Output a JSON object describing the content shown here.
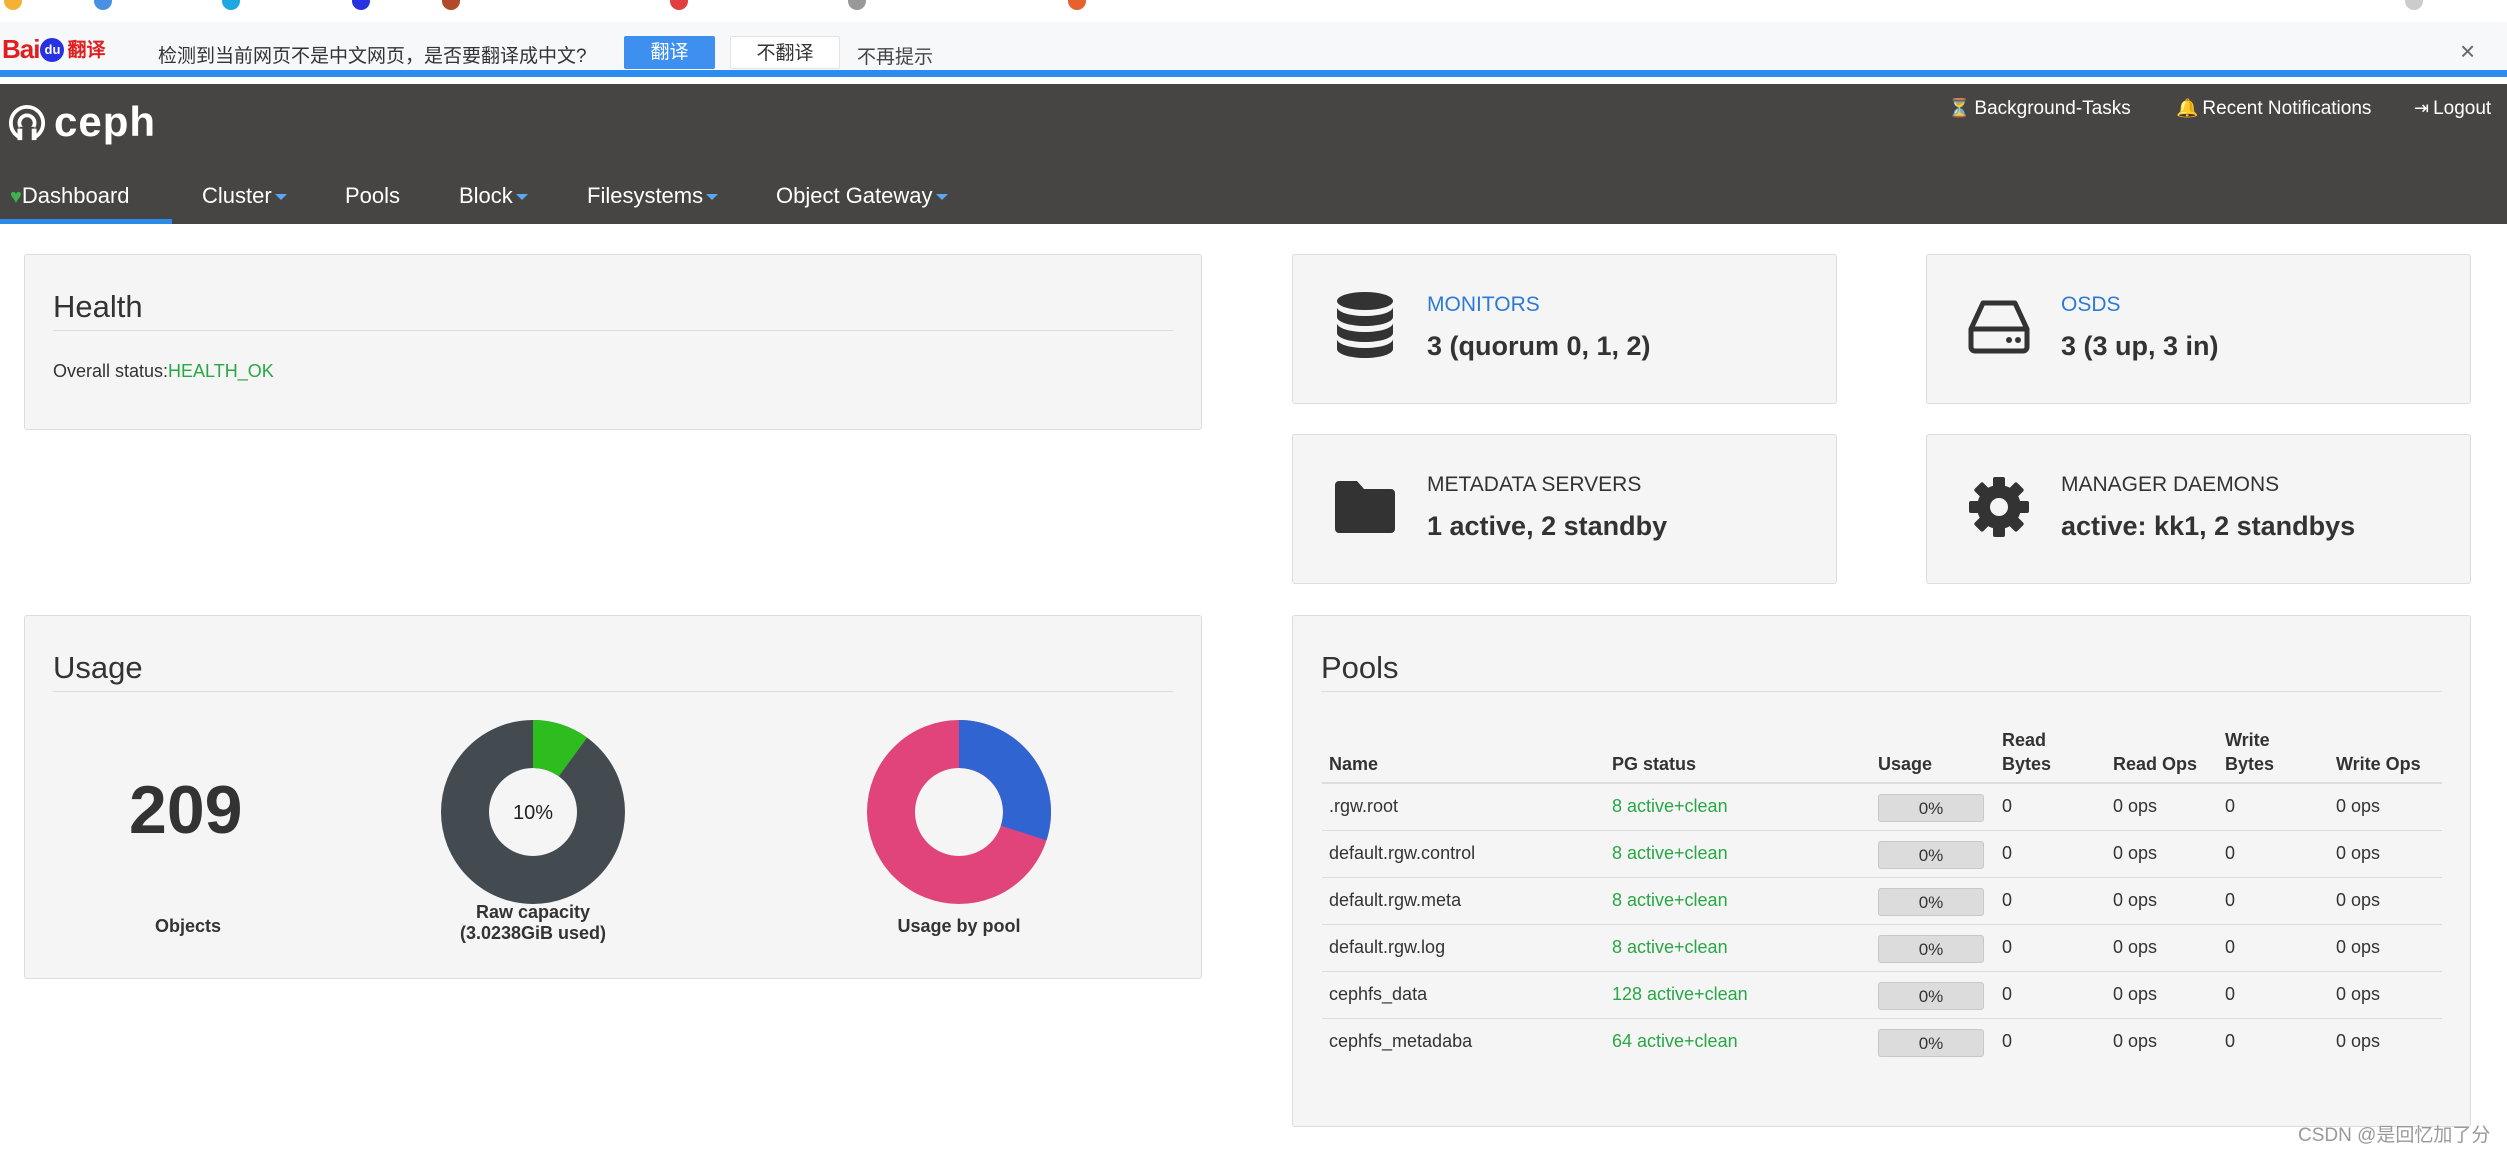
{
  "translate_bar": {
    "logo_bai": "Bai",
    "logo_du": "du",
    "logo_fanyi": "翻译",
    "message": "检测到当前网页不是中文网页，是否要翻译成中文?",
    "translate_button": "翻译",
    "no_translate_button": "不翻译",
    "never_show": "不再提示",
    "close_glyph": "×"
  },
  "header": {
    "brand": "ceph",
    "links": {
      "background_tasks": "Background-Tasks",
      "recent_notifications": "Recent Notifications",
      "logout": "Logout"
    },
    "nav": [
      {
        "label": "Dashboard",
        "active": true,
        "icon": "heartbeat-icon"
      },
      {
        "label": "Cluster",
        "dropdown": true
      },
      {
        "label": "Pools"
      },
      {
        "label": "Block",
        "dropdown": true
      },
      {
        "label": "Filesystems",
        "dropdown": true
      },
      {
        "label": "Object Gateway",
        "dropdown": true
      }
    ]
  },
  "health": {
    "title": "Health",
    "status_label": "Overall status:",
    "status_value": "HEALTH_OK"
  },
  "cards": {
    "monitors": {
      "label": "MONITORS",
      "value": "3 (quorum 0, 1, 2)",
      "icon": "database-icon"
    },
    "osds": {
      "label": "OSDS",
      "value": "3 (3 up, 3 in)",
      "icon": "hard-drive-icon"
    },
    "mds": {
      "label": "METADATA SERVERS",
      "value": "1 active, 2 standby",
      "icon": "folder-icon"
    },
    "mgr": {
      "label": "MANAGER DAEMONS",
      "value": "active: kk1, 2 standbys",
      "icon": "gear-icon"
    }
  },
  "usage": {
    "title": "Usage",
    "objects_count": "209",
    "objects_label": "Objects",
    "raw_capacity_center": "10%",
    "raw_capacity_label_1": "Raw capacity",
    "raw_capacity_label_2": "(3.0238GiB used)",
    "raw_capacity_fraction": 0.1,
    "usage_by_pool_label": "Usage by pool",
    "usage_by_pool_fraction_blue": 0.3,
    "colors": {
      "dark": "#434b50",
      "green": "#2ebd1e",
      "pink": "#e0447a",
      "blue": "#3064d0"
    }
  },
  "pools": {
    "title": "Pools",
    "columns": {
      "name": "Name",
      "pg_status": "PG status",
      "usage": "Usage",
      "read_bytes_1": "Read",
      "read_bytes_2": "Bytes",
      "read_ops": "Read Ops",
      "write_bytes_1": "Write",
      "write_bytes_2": "Bytes",
      "write_ops": "Write Ops"
    },
    "rows": [
      {
        "name": ".rgw.root",
        "pg": "8 active+clean",
        "usage": "0%",
        "read_bytes": "0",
        "read_ops": "0 ops",
        "write_bytes": "0",
        "write_ops": "0 ops"
      },
      {
        "name": "default.rgw.control",
        "pg": "8 active+clean",
        "usage": "0%",
        "read_bytes": "0",
        "read_ops": "0 ops",
        "write_bytes": "0",
        "write_ops": "0 ops"
      },
      {
        "name": "default.rgw.meta",
        "pg": "8 active+clean",
        "usage": "0%",
        "read_bytes": "0",
        "read_ops": "0 ops",
        "write_bytes": "0",
        "write_ops": "0 ops"
      },
      {
        "name": "default.rgw.log",
        "pg": "8 active+clean",
        "usage": "0%",
        "read_bytes": "0",
        "read_ops": "0 ops",
        "write_bytes": "0",
        "write_ops": "0 ops"
      },
      {
        "name": "cephfs_data",
        "pg": "128 active+clean",
        "usage": "0%",
        "read_bytes": "0",
        "read_ops": "0 ops",
        "write_bytes": "0",
        "write_ops": "0 ops"
      },
      {
        "name": "cephfs_metadaba",
        "pg": "64 active+clean",
        "usage": "0%",
        "read_bytes": "0",
        "read_ops": "0 ops",
        "write_bytes": "0",
        "write_ops": "0 ops"
      }
    ]
  },
  "watermark": "CSDN @是回忆加了分"
}
